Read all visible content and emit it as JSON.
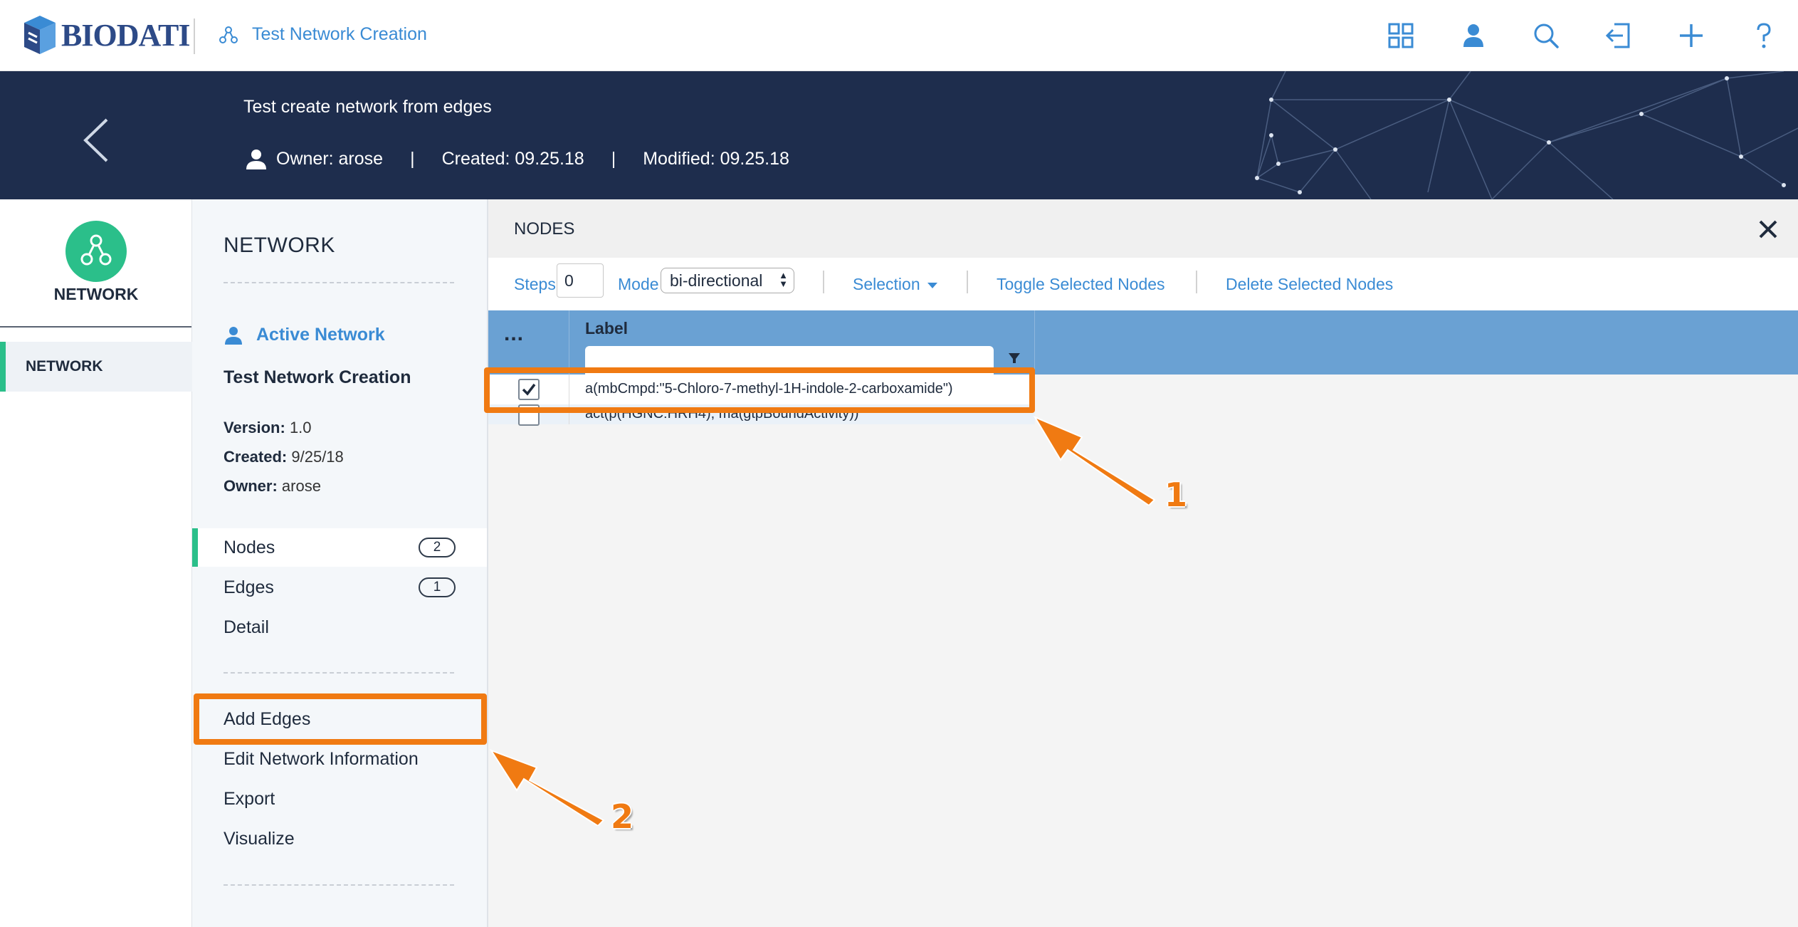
{
  "app": {
    "logo_text": "BIODATI",
    "breadcrumb": "Test Network Creation",
    "top_icons": [
      "apps-grid-icon",
      "user-icon",
      "search-icon",
      "import-icon",
      "plus-icon",
      "help-icon"
    ],
    "accent_color": "#3a8bd4",
    "brand_green": "#2bbf8a",
    "highlight_color": "#f07a12"
  },
  "banner": {
    "title": "Test create network from edges",
    "owner": "Owner: arose",
    "separator": "|",
    "created": "Created: 09.25.18",
    "modified": "Modified: 09.25.18"
  },
  "rail": {
    "title": "NETWORK",
    "items": [
      {
        "label": "NETWORK"
      }
    ]
  },
  "panel": {
    "title": "NETWORK",
    "active_label": "Active Network",
    "network_name": "Test Network Creation",
    "version_key": "Version:",
    "version_val": "1.0",
    "created_key": "Created:",
    "created_val": "9/25/18",
    "owner_key": "Owner:",
    "owner_val": "arose",
    "nav": [
      {
        "label": "Nodes",
        "count": "2"
      },
      {
        "label": "Edges",
        "count": "1"
      },
      {
        "label": "Detail"
      }
    ],
    "actions": [
      "Add Edges",
      "Edit Network Information",
      "Export",
      "Visualize"
    ]
  },
  "nodes": {
    "title": "NODES",
    "steps_label": "Steps",
    "steps_value": "0",
    "mode_label": "Mode",
    "mode_value": "bi-directional",
    "selection_label": "Selection",
    "toggle_label": "Toggle Selected Nodes",
    "delete_label": "Delete Selected Nodes",
    "grid": {
      "menu_label": "...",
      "column_label": "Label",
      "rows": [
        {
          "label": "a(mbCmpd:\"5-Chloro-7-methyl-1H-indole-2-carboxamide\")",
          "checked": true
        },
        {
          "label": "act(p(HGNC:HRH4), ma(gtpBoundActivity))",
          "checked": false
        }
      ]
    }
  },
  "annotations": {
    "one": "1",
    "two": "2"
  }
}
